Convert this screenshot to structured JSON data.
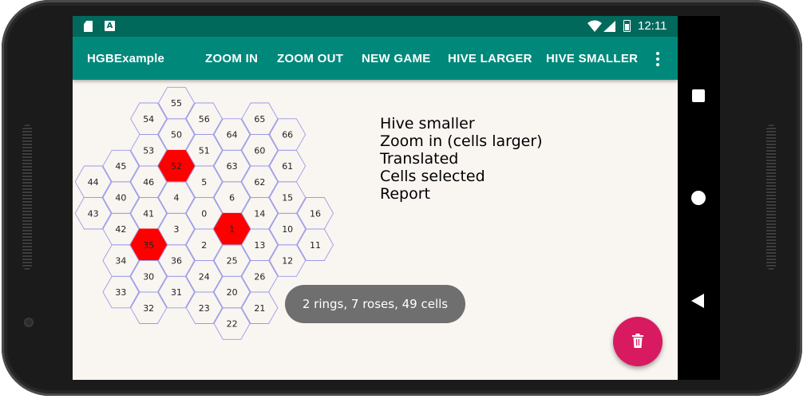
{
  "status_bar": {
    "time": "12:11",
    "left_icons": [
      "sd-card-icon",
      "a-notification-icon"
    ],
    "right_icons": [
      "wifi-icon",
      "signal-icon",
      "battery-icon"
    ]
  },
  "app_bar": {
    "title": "HGBExample",
    "actions": [
      "ZOOM IN",
      "ZOOM OUT",
      "NEW GAME",
      "HIVE LARGER",
      "HIVE SMALLER"
    ],
    "overflow_icon": "more-vert-icon",
    "background": "#00897b",
    "status_background": "#00695c"
  },
  "hive": {
    "cell_stroke": "#9a9ae6",
    "selected_fill": "#ff0000",
    "selected_cells": [
      52,
      1,
      35
    ],
    "cells": [
      {
        "n": 55,
        "c": 0,
        "r": 0
      },
      {
        "n": 54,
        "c": -1,
        "r": 0.5
      },
      {
        "n": 56,
        "c": 1,
        "r": 0.5
      },
      {
        "n": 65,
        "c": 3,
        "r": 0.5
      },
      {
        "n": 50,
        "c": 0,
        "r": 1
      },
      {
        "n": 64,
        "c": 2,
        "r": 1
      },
      {
        "n": 66,
        "c": 4,
        "r": 1
      },
      {
        "n": 53,
        "c": -1,
        "r": 1.5
      },
      {
        "n": 51,
        "c": 1,
        "r": 1.5
      },
      {
        "n": 60,
        "c": 3,
        "r": 1.5
      },
      {
        "n": 45,
        "c": -2,
        "r": 2
      },
      {
        "n": 52,
        "c": 0,
        "r": 2
      },
      {
        "n": 63,
        "c": 2,
        "r": 2
      },
      {
        "n": 61,
        "c": 4,
        "r": 2
      },
      {
        "n": 44,
        "c": -3,
        "r": 2.5
      },
      {
        "n": 46,
        "c": -1,
        "r": 2.5
      },
      {
        "n": 5,
        "c": 1,
        "r": 2.5
      },
      {
        "n": 62,
        "c": 3,
        "r": 2.5
      },
      {
        "n": 40,
        "c": -2,
        "r": 3
      },
      {
        "n": 4,
        "c": 0,
        "r": 3
      },
      {
        "n": 6,
        "c": 2,
        "r": 3
      },
      {
        "n": 15,
        "c": 4,
        "r": 3
      },
      {
        "n": 43,
        "c": -3,
        "r": 3.5
      },
      {
        "n": 41,
        "c": -1,
        "r": 3.5
      },
      {
        "n": 0,
        "c": 1,
        "r": 3.5
      },
      {
        "n": 14,
        "c": 3,
        "r": 3.5
      },
      {
        "n": 16,
        "c": 5,
        "r": 3.5
      },
      {
        "n": 42,
        "c": -2,
        "r": 4
      },
      {
        "n": 3,
        "c": 0,
        "r": 4
      },
      {
        "n": 1,
        "c": 2,
        "r": 4
      },
      {
        "n": 10,
        "c": 4,
        "r": 4
      },
      {
        "n": 35,
        "c": -1,
        "r": 4.5
      },
      {
        "n": 2,
        "c": 1,
        "r": 4.5
      },
      {
        "n": 13,
        "c": 3,
        "r": 4.5
      },
      {
        "n": 11,
        "c": 5,
        "r": 4.5
      },
      {
        "n": 34,
        "c": -2,
        "r": 5
      },
      {
        "n": 36,
        "c": 0,
        "r": 5
      },
      {
        "n": 25,
        "c": 2,
        "r": 5
      },
      {
        "n": 12,
        "c": 4,
        "r": 5
      },
      {
        "n": 30,
        "c": -1,
        "r": 5.5
      },
      {
        "n": 24,
        "c": 1,
        "r": 5.5
      },
      {
        "n": 26,
        "c": 3,
        "r": 5.5
      },
      {
        "n": 33,
        "c": -2,
        "r": 6
      },
      {
        "n": 31,
        "c": 0,
        "r": 6
      },
      {
        "n": 20,
        "c": 2,
        "r": 6
      },
      {
        "n": 32,
        "c": -1,
        "r": 6.5
      },
      {
        "n": 23,
        "c": 1,
        "r": 6.5
      },
      {
        "n": 21,
        "c": 3,
        "r": 6.5
      },
      {
        "n": 22,
        "c": 2,
        "r": 7
      }
    ]
  },
  "menu_log": [
    "Hive smaller",
    "Zoom in (cells larger)",
    "Translated",
    "Cells selected",
    "Report"
  ],
  "toast": "2 rings, 7 roses, 49 cells",
  "fab": {
    "icon": "delete-icon",
    "color": "#d81b60"
  },
  "nav_bar": {
    "icons": [
      "recent-apps-icon",
      "home-icon",
      "back-icon"
    ]
  }
}
